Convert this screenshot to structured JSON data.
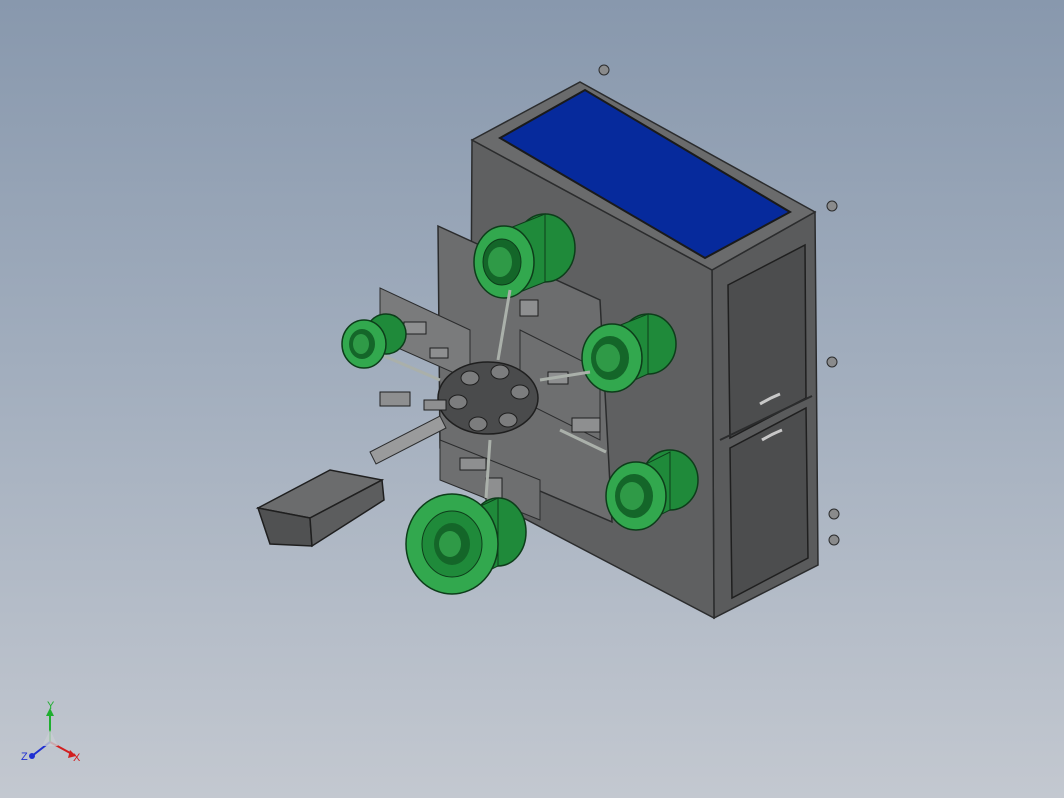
{
  "viewport": {
    "background_top": "#8898ad",
    "background_bottom": "#c3c8d0"
  },
  "model": {
    "colors": {
      "frame": "#5d5e5f",
      "frame_dark": "#3f4041",
      "frame_edge": "#2b2c2d",
      "panel_blue": "#062a9c",
      "part_green": "#1f8a3a",
      "part_green_light": "#32a84e",
      "part_green_dark": "#146629",
      "plate": "#6a6b6c",
      "cover": "#4a4b4c"
    }
  },
  "triad": {
    "x_label": "X",
    "y_label": "Y",
    "z_label": "Z",
    "x_color": "#d21f1f",
    "y_color": "#1fae2f",
    "z_color": "#1f2fd2"
  }
}
